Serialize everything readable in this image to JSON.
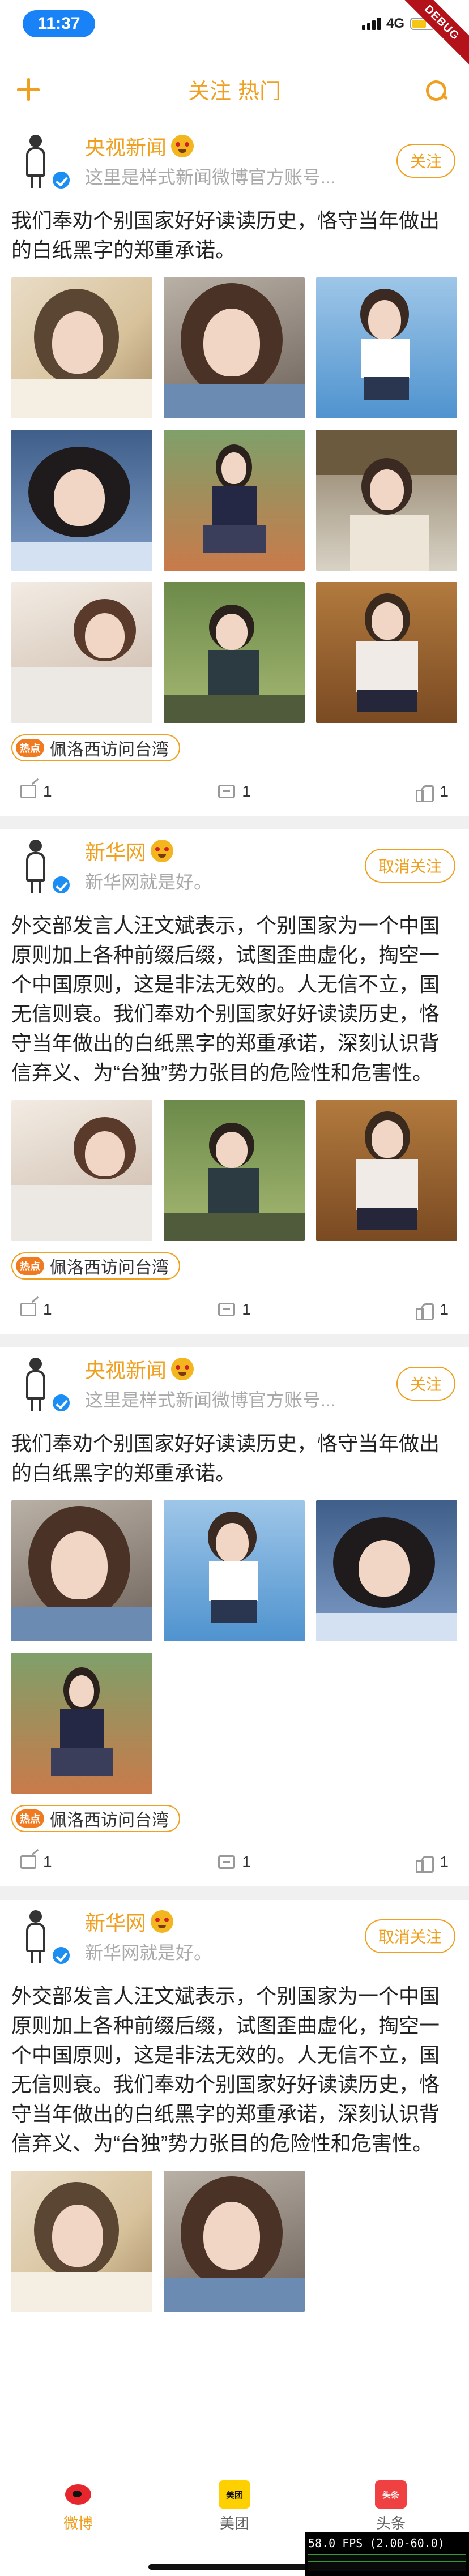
{
  "status_bar": {
    "time": "11:37",
    "network": "4G",
    "debug_banner": "DEBUG"
  },
  "nav": {
    "tab_follow": "关注",
    "tab_hot": "热门",
    "accent_color": "#f0a020"
  },
  "posts": [
    {
      "author": "央视新闻",
      "desc": "这里是样式新闻微博官方账号...",
      "follow_label": "关注",
      "text": "我们奉劝个别国家好好读读历史，恪守当年做出的白纸黑字的郑重承诺。",
      "image_count": 9,
      "tag_badge": "热点",
      "tag": "佩洛西访问台湾",
      "shares": "1",
      "comments": "1",
      "likes": "1"
    },
    {
      "author": "新华网",
      "desc": "新华网就是好。",
      "follow_label": "取消关注",
      "text": "外交部发言人汪文斌表示，个别国家为一个中国原则加上各种前缀后缀，试图歪曲虚化，掏空一个中国原则，这是非法无效的。人无信不立，国无信则衰。我们奉劝个别国家好好读读历史，恪守当年做出的白纸黑字的郑重承诺，深刻认识背信弃义、为“台独”势力张目的危险性和危害性。",
      "image_count": 3,
      "tag_badge": "热点",
      "tag": "佩洛西访问台湾",
      "shares": "1",
      "comments": "1",
      "likes": "1"
    },
    {
      "author": "央视新闻",
      "desc": "这里是样式新闻微博官方账号...",
      "follow_label": "关注",
      "text": "我们奉劝个别国家好好读读历史，恪守当年做出的白纸黑字的郑重承诺。",
      "image_count": 4,
      "tag_badge": "热点",
      "tag": "佩洛西访问台湾",
      "shares": "1",
      "comments": "1",
      "likes": "1"
    },
    {
      "author": "新华网",
      "desc": "新华网就是好。",
      "follow_label": "取消关注",
      "text": "外交部发言人汪文斌表示，个别国家为一个中国原则加上各种前缀后缀，试图歪曲虚化，掏空一个中国原则，这是非法无效的。人无信不立，国无信则衰。我们奉劝个别国家好好读读历史，恪守当年做出的白纸黑字的郑重承诺，深刻认识背信弃义、为“台独”势力张目的危险性和危害性。",
      "image_count": 2
    }
  ],
  "tabbar": {
    "weibo": "微博",
    "meituan": "美团",
    "meituan_logo": "美团",
    "toutiao": "头条",
    "toutiao_logo": "头条",
    "active_color": "#f0a020"
  },
  "fps": {
    "label": "58.0 FPS (2.00-60.0)"
  }
}
